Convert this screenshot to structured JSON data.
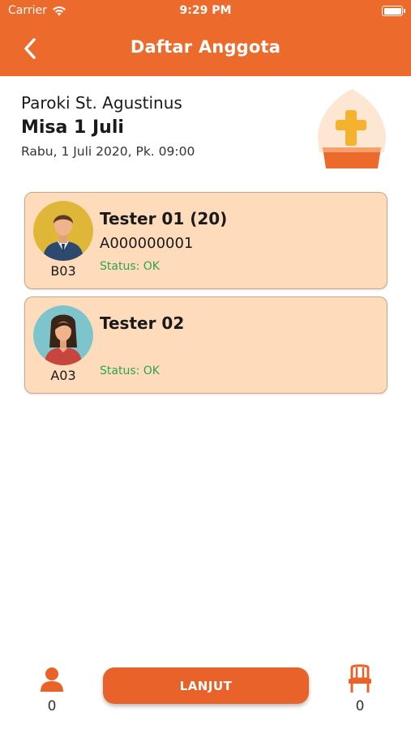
{
  "status_bar": {
    "carrier": "Carrier",
    "time": "9:29 PM"
  },
  "header": {
    "title": "Daftar Anggota"
  },
  "event": {
    "parish": "Paroki St. Agustinus",
    "title": "Misa 1 Juli",
    "datetime": "Rabu, 1 Juli 2020, Pk. 09:00"
  },
  "members": [
    {
      "name": "Tester 01 (20)",
      "id": "A000000001",
      "status": "Status: OK",
      "seat": "B03",
      "avatar": "male-avatar-icon"
    },
    {
      "name": "Tester 02",
      "id": "",
      "status": "Status: OK",
      "seat": "A03",
      "avatar": "female-avatar-icon"
    }
  ],
  "bottom": {
    "people_count": "0",
    "button_label": "LANJUT",
    "seat_count": "0"
  },
  "colors": {
    "primary": "#ec6a2b",
    "card_bg": "#fddbbb",
    "status_ok": "#2ea44f"
  }
}
